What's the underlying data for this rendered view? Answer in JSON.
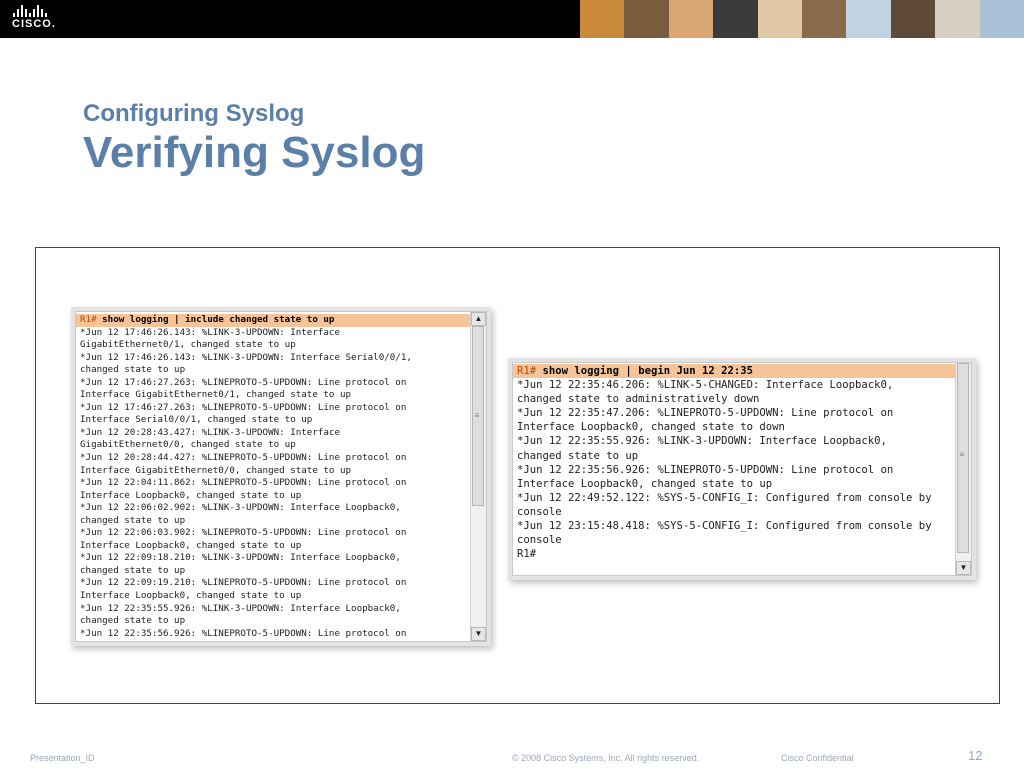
{
  "header": {
    "logo_text": "CISCO.",
    "photo_colors": [
      "#c98a3a",
      "#7a5b3e",
      "#d9a673",
      "#3b3b3b",
      "#e2c9a6",
      "#8a6a4a",
      "#c1d3e0",
      "#5f4a3a",
      "#d8d0c4",
      "#a9c2d8"
    ]
  },
  "slide": {
    "subtitle": "Configuring Syslog",
    "title": "Verifying Syslog"
  },
  "terminal1": {
    "prompt": "R1#",
    "command": " show logging | include changed state to up",
    "lines": [
      "*Jun 12 17:46:26.143: %LINK-3-UPDOWN: Interface",
      "GigabitEthernet0/1, changed state to up",
      "*Jun 12 17:46:26.143: %LINK-3-UPDOWN: Interface Serial0/0/1,",
      "changed state to up",
      "*Jun 12 17:46:27.263: %LINEPROTO-5-UPDOWN: Line protocol on",
      "Interface GigabitEthernet0/1, changed state to up",
      "*Jun 12 17:46:27.263: %LINEPROTO-5-UPDOWN: Line protocol on",
      "Interface Serial0/0/1, changed state to up",
      "*Jun 12 20:28:43.427: %LINK-3-UPDOWN: Interface",
      "GigabitEthernet0/0, changed state to up",
      "*Jun 12 20:28:44.427: %LINEPROTO-5-UPDOWN: Line protocol on",
      "Interface GigabitEthernet0/0, changed state to up",
      "*Jun 12 22:04:11.862: %LINEPROTO-5-UPDOWN: Line protocol on",
      "Interface Loopback0, changed state to up",
      "*Jun 12 22:06:02.902: %LINK-3-UPDOWN: Interface Loopback0,",
      "changed state to up",
      "*Jun 12 22:06:03.902: %LINEPROTO-5-UPDOWN: Line protocol on",
      "Interface Loopback0, changed state to up",
      "*Jun 12 22:09:18.210: %LINK-3-UPDOWN: Interface Loopback0,",
      "changed state to up",
      "*Jun 12 22:09:19.210: %LINEPROTO-5-UPDOWN: Line protocol on",
      "Interface Loopback0, changed state to up",
      "*Jun 12 22:35:55.926: %LINK-3-UPDOWN: Interface Loopback0,",
      "changed state to up",
      "*Jun 12 22:35:56.926: %LINEPROTO-5-UPDOWN: Line protocol on"
    ]
  },
  "terminal2": {
    "prompt": "R1#",
    "command": " show logging | begin Jun 12 22:35",
    "lines": [
      "*Jun 12 22:35:46.206: %LINK-5-CHANGED: Interface Loopback0,",
      "changed state to administratively down",
      "*Jun 12 22:35:47.206: %LINEPROTO-5-UPDOWN: Line protocol on",
      "Interface Loopback0, changed state to down",
      "*Jun 12 22:35:55.926: %LINK-3-UPDOWN: Interface Loopback0,",
      "changed state to up",
      "*Jun 12 22:35:56.926: %LINEPROTO-5-UPDOWN: Line protocol on",
      "Interface Loopback0, changed state to up",
      "*Jun 12 22:49:52.122: %SYS-5-CONFIG_I: Configured from console by",
      "console",
      "*Jun 12 23:15:48.418: %SYS-5-CONFIG_I: Configured from console by",
      "console",
      "R1#"
    ]
  },
  "footer": {
    "presentation_id": "Presentation_ID",
    "copyright": "© 2008 Cisco Systems, Inc. All rights reserved.",
    "confidential": "Cisco Confidential",
    "page_number": "12"
  }
}
